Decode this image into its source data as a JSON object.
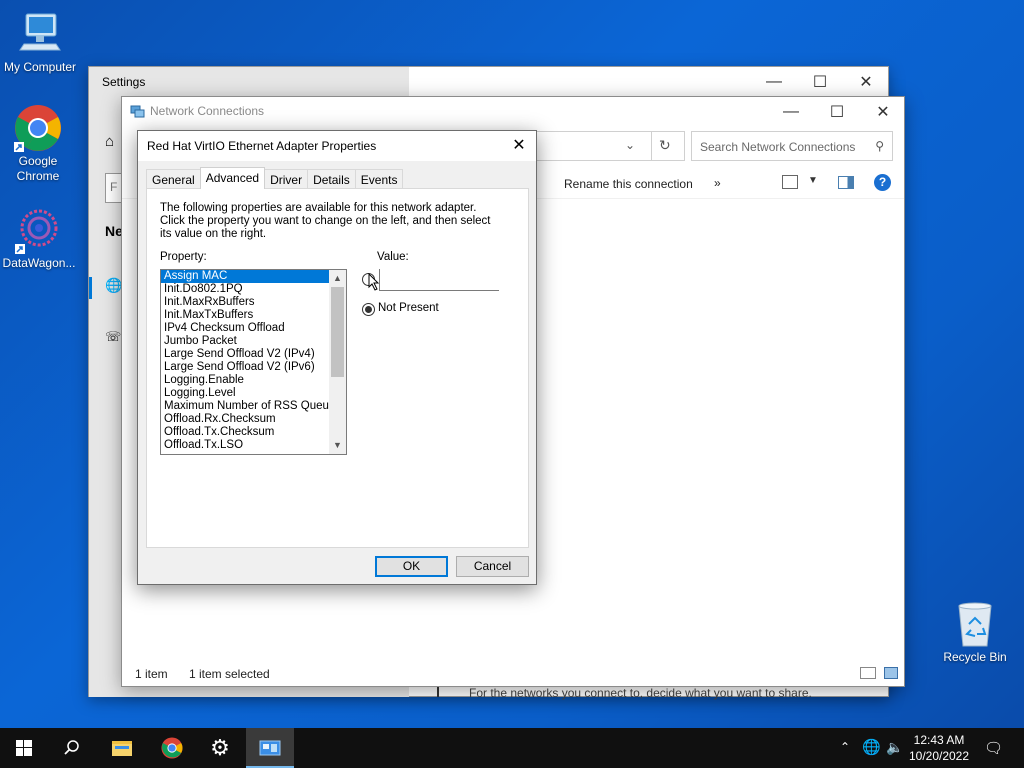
{
  "desktop": {
    "icons": [
      {
        "label": "My Computer"
      },
      {
        "label": "Google Chrome"
      },
      {
        "label": "DataWagon..."
      },
      {
        "label": "Recycle Bin"
      }
    ]
  },
  "settings_window": {
    "title": "Settings",
    "header_partial": "Ne",
    "search_partial": "F",
    "bottom_text": "For the networks you connect to, decide what you want to share."
  },
  "network_window": {
    "title": "Network Connections",
    "search_placeholder": "Search Network Connections",
    "command": "Rename this connection",
    "more": "»",
    "status_count": "1 item",
    "status_selected": "1 item selected"
  },
  "dialog": {
    "title": "Red Hat VirtIO Ethernet Adapter Properties",
    "tabs": [
      "General",
      "Advanced",
      "Driver",
      "Details",
      "Events"
    ],
    "active_tab": "Advanced",
    "description": "The following properties are available for this network adapter. Click the property you want to change on the left, and then select its value on the right.",
    "property_label": "Property:",
    "value_label": "Value:",
    "properties": [
      "Assign MAC",
      "Init.Do802.1PQ",
      "Init.MaxRxBuffers",
      "Init.MaxTxBuffers",
      "IPv4 Checksum Offload",
      "Jumbo Packet",
      "Large Send Offload V2 (IPv4)",
      "Large Send Offload V2 (IPv6)",
      "Logging.Enable",
      "Logging.Level",
      "Maximum Number of RSS Queues",
      "Offload.Rx.Checksum",
      "Offload.Tx.Checksum",
      "Offload.Tx.LSO"
    ],
    "selected_property": "Assign MAC",
    "value_text": "",
    "not_present_label": "Not Present",
    "ok_label": "OK",
    "cancel_label": "Cancel"
  },
  "taskbar": {
    "time": "12:43 AM",
    "date": "10/20/2022"
  },
  "colors": {
    "accent": "#0078d7",
    "taskbar": "#101010",
    "desktop": "#0b66d6"
  }
}
